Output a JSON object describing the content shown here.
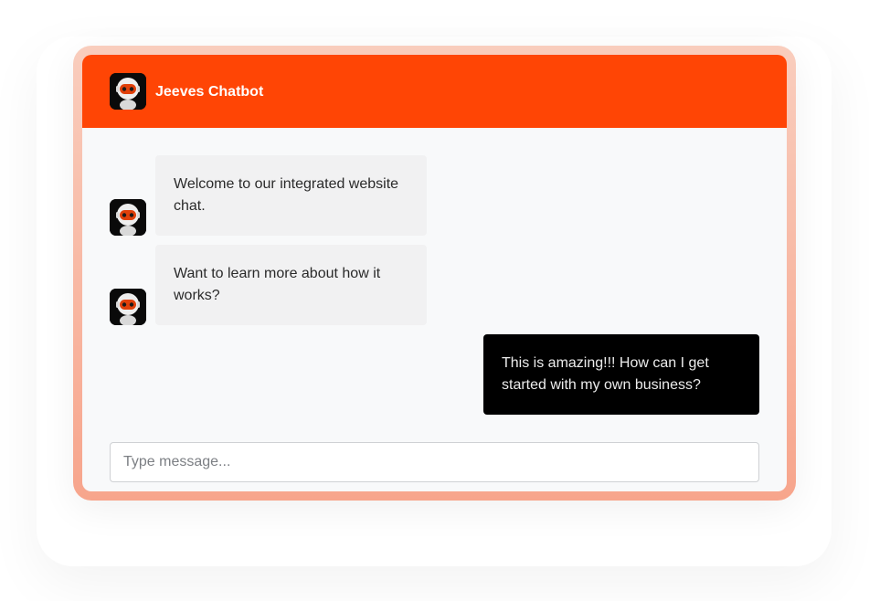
{
  "header": {
    "title": "Jeeves Chatbot",
    "bg_color": "#ff4505",
    "avatar_icon": "robot-icon"
  },
  "messages": [
    {
      "sender": "bot",
      "text": "Welcome to our integrated website chat."
    },
    {
      "sender": "bot",
      "text": "Want to learn more about how it works?"
    },
    {
      "sender": "user",
      "text": "This is amazing!!! How can I get started with my own business?"
    }
  ],
  "composer": {
    "placeholder": "Type message...",
    "value": ""
  },
  "colors": {
    "accent": "#ff4505",
    "frame_gradient_top": "#f9cdbd",
    "frame_gradient_bottom": "#f7a58c",
    "bot_bubble": "#f1f1f2",
    "user_bubble": "#000000"
  }
}
